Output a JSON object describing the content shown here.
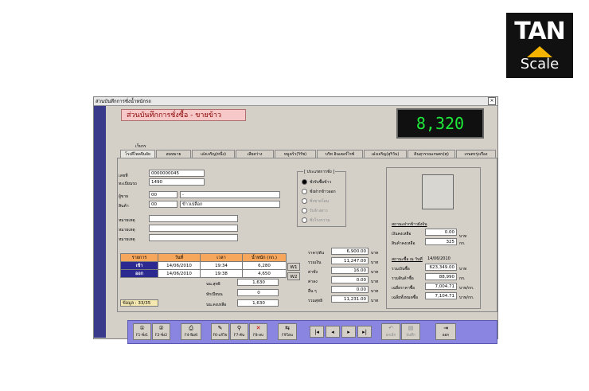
{
  "logo": {
    "top": "TAN",
    "bottom": "Scale"
  },
  "window": {
    "title": "ส่วนบันทึกการซั่งน้ำหนักรถ",
    "close": "×"
  },
  "heading": "ส่วนบันทึกการชั่งซื้อ - ขายข้าว",
  "display": "8,320",
  "tab_group": "เว็บกร",
  "tabs": [
    "โรงสีไพลจีนจัย",
    "สมหมาย",
    "เอ๋งเจริญ(หนึ่ง)",
    "เลียสว่าง",
    "หมูคร้ว(วิรัช)",
    "บริท อินเตอร์ไรซ์",
    "เอ๋งเจริญ(สุริวัน)",
    "ดินสุวรรณเกษตร(ศุ)",
    "เกษตรรุ่งเรือง"
  ],
  "form": {
    "doc_no_label": "เลขที่",
    "doc_no": "0000000045",
    "plate_label": "ทะเบียนรถ",
    "plate": "1490",
    "seller_label": "ผู้ขาย",
    "seller_code": "00",
    "seller_name": "-",
    "product_label": "สินค้า",
    "product_code": "00",
    "product_name": "ข้าวเปลือก",
    "note_label1": "หมายเหตุ",
    "note_label2": "หมายเหตุ",
    "note_label3": "หมายเหตุ",
    "note1": "",
    "note2": "",
    "note3": ""
  },
  "radio_group": {
    "title": "[ ประเภทการชั่ง ]",
    "options": [
      {
        "label": "ชั่งรับซื้อข้าว",
        "selected": true,
        "enabled": true
      },
      {
        "label": "ชั่งฝากข้าวออก",
        "selected": false,
        "enabled": true
      },
      {
        "label": "ชั่งขายโอน",
        "selected": false,
        "enabled": false
      },
      {
        "label": "รับจ้างสาว",
        "selected": false,
        "enabled": false
      },
      {
        "label": "ชั่งโรงกวาม",
        "selected": false,
        "enabled": false
      }
    ]
  },
  "weights": {
    "headers": [
      "รายการ",
      "วันที่",
      "เวลา",
      "น้ำหนัก (กก.)"
    ],
    "in": {
      "label": "เข้า",
      "date": "14/06/2010",
      "time": "19:34",
      "weight": "6,280"
    },
    "out": {
      "label": "ออก",
      "date": "14/06/2010",
      "time": "19:38",
      "weight": "4,650"
    },
    "net_label": "นน.สุทธิ",
    "net": "1,630",
    "deduct_label": "หักเปียบน",
    "deduct": "0",
    "remain_label": "นน.คงเหลือ",
    "remain": "1,630",
    "w1": "W1",
    "w2": "W2"
  },
  "record": {
    "label": "ข้อมูล",
    "value": "33/35"
  },
  "price": {
    "unit_label": "ราคา/ตัน",
    "unit": "6,900.00",
    "total_label": "รวมเงิน",
    "total": "11,247.00",
    "fee_label": "ค่าชั่ง",
    "fee": "16.00",
    "labor_label": "ค่าลง",
    "labor": "0.00",
    "other_label": "อื่น ๆ",
    "other": "0.00",
    "net_label": "รวมสุทธิ",
    "net": "11,231.00",
    "baht": "บาท"
  },
  "deposit": {
    "title": "สถานะฝากข้าวยังจ้น",
    "money_label": "เงินคงเหลือ",
    "money": "0.00",
    "money_unit": "บาท",
    "goods_label": "สินค้าคงเหลือ",
    "goods": "325",
    "goods_unit": "กก."
  },
  "summary": {
    "title": "สถานะซื้อ ณ วันที่",
    "date": "14/06/2010",
    "buy_label": "รวมเงินซื้อ",
    "buy": "623,349.00",
    "buy_unit": "บาท",
    "qty_label": "รวมสินค้าซื้อ",
    "qty": "88,990",
    "qty_unit": "กก.",
    "avg_label": "เฉลี่ยราคาซื้อ",
    "avg": "7,004.71",
    "avg_unit": "บาท/กก.",
    "avg_all_label": "เฉลี่ยทั้งหมดซื้อ",
    "avg_all": "7,104.71",
    "avg_all_unit": "บาท/กก."
  },
  "toolbar": {
    "f1": "F1-ชั่ง1",
    "f2": "F2-ชั่ง2",
    "f4": "F4-พิมพ์",
    "f6": "F6-แก้ไข",
    "f7": "F7-ค้น",
    "f8": "F8-ลบ",
    "f9": "F9โอน",
    "cancel": "ยกเลิก",
    "save": "บันทึก",
    "exit": "ออก"
  }
}
